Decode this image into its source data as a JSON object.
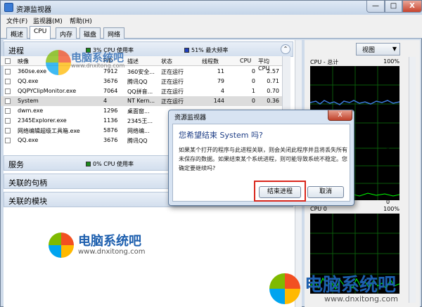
{
  "window": {
    "title": "资源监视器",
    "min": "—",
    "max": "□",
    "close": "X"
  },
  "menu": [
    "文件(F)",
    "监视器(M)",
    "帮助(H)"
  ],
  "tabs": [
    "概述",
    "CPU",
    "内存",
    "磁盘",
    "网络"
  ],
  "process_section": {
    "title": "进程",
    "cpu_usage": "3% CPU 使用率",
    "max_freq": "51% 最大频率",
    "columns": [
      "映像",
      "PID",
      "描述",
      "状态",
      "线程数",
      "CPU",
      "平均 CPU"
    ],
    "rows": [
      {
        "image": "360se.exe",
        "pid": "7912",
        "desc": "360安全...",
        "status": "正在运行",
        "threads": "11",
        "cpu": "0",
        "avg": "2.57"
      },
      {
        "image": "QQ.exe",
        "pid": "3676",
        "desc": "腾讯QQ",
        "status": "正在运行",
        "threads": "79",
        "cpu": "0",
        "avg": "0.71"
      },
      {
        "image": "QQPYClipMonitor.exe",
        "pid": "7064",
        "desc": "QQ拼音...",
        "status": "正在运行",
        "threads": "4",
        "cpu": "1",
        "avg": "0.70"
      },
      {
        "image": "System",
        "pid": "4",
        "desc": "NT Kern...",
        "status": "正在运行",
        "threads": "144",
        "cpu": "0",
        "avg": "0.36"
      },
      {
        "image": "dwm.exe",
        "pid": "1296",
        "desc": "桌面窗...",
        "status": "",
        "threads": "",
        "cpu": "",
        "avg": ""
      },
      {
        "image": "2345Explorer.exe",
        "pid": "1136",
        "desc": "2345王...",
        "status": "",
        "threads": "",
        "cpu": "",
        "avg": ""
      },
      {
        "image": "网络编辑超级工具箱.exe",
        "pid": "5876",
        "desc": "网络编...",
        "status": "",
        "threads": "",
        "cpu": "",
        "avg": ""
      },
      {
        "image": "QQ.exe",
        "pid": "3676",
        "desc": "腾讯QQ",
        "status": "",
        "threads": "",
        "cpu": "",
        "avg": ""
      }
    ]
  },
  "services_section": {
    "title": "服务",
    "cpu_usage": "0% CPU 使用率"
  },
  "handles_section": {
    "title": "关联的句柄"
  },
  "modules_section": {
    "title": "关联的模块"
  },
  "view_button": "视图",
  "graphs": [
    {
      "label": "CPU - 总计",
      "percent": "100%",
      "bottom": "0"
    },
    {
      "label": "",
      "percent": "100%",
      "bottom": "0"
    },
    {
      "label": "CPU 0",
      "percent": "100%",
      "bottom": ""
    }
  ],
  "dialog": {
    "title": "资源监视器",
    "close": "X",
    "question": "您希望结束 System 吗?",
    "message": "如果某个打开的程序与此进程关联，则会关闭此程序并且将丢失所有未保存的数据。如果结束某个系统进程，则可能导致系统不稳定。您确定要继续吗?",
    "confirm": "结束进程",
    "cancel": "取消"
  },
  "watermarks": [
    {
      "name": "电脑系统吧",
      "url": "www.dnxitong.com"
    },
    {
      "name": "电脑系统吧",
      "url": "www.dnxitong.com"
    },
    {
      "name": "电脑系统吧",
      "url": "www.dnxitong.com"
    }
  ],
  "colors": {
    "accent": "#1d5fae",
    "graph_line": "#00ff00",
    "graph_blue": "#3c78d8",
    "red_highlight": "#d9261c"
  }
}
